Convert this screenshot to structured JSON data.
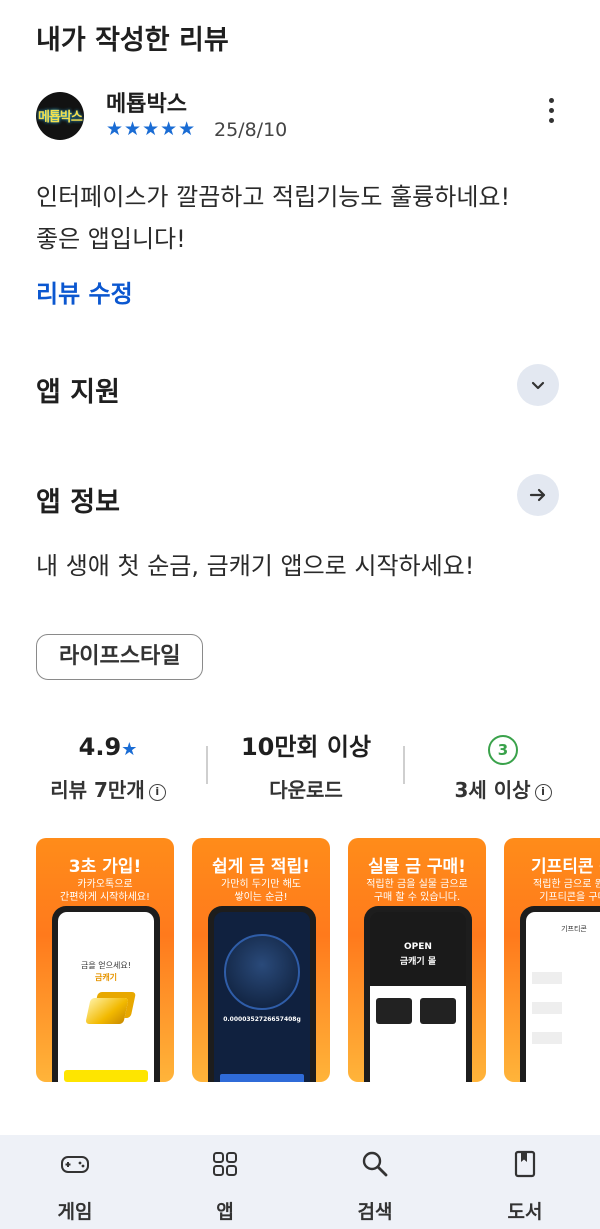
{
  "my_review": {
    "section_title": "내가 작성한 리뷰",
    "reviewer_name": "메툡박스",
    "avatar_text": "메툡박스",
    "stars": "★★★★★",
    "rating": 5,
    "date": "25/8/10",
    "text_line1": "인터페이스가 깔끔하고 적립기능도 훌륭하네요!",
    "text_line2": "좋은 앱입니다!",
    "edit_label": "리뷰 수정"
  },
  "app_support": {
    "title": "앱 지원"
  },
  "app_info": {
    "title": "앱 정보",
    "description": "내 생애 첫 순금, 금캐기 앱으로 시작하세요!",
    "category_chip": "라이프스타일"
  },
  "stats": {
    "rating_value": "4.9",
    "rating_star": "★",
    "reviews_label": "리뷰 7만개",
    "downloads_value": "10만회 이상",
    "downloads_label": "다운로드",
    "age_value": "3",
    "age_label": "3세 이상"
  },
  "screenshots": [
    {
      "title": "3초 가입!",
      "subtitle": "카카오톡으로\n간편하게 시작하세요!",
      "screen_text1": "금을 얻으세요!",
      "screen_text2": "금캐기"
    },
    {
      "title": "쉽게 금 적립!",
      "subtitle": "가만히 두기만 해도\n쌓이는 순금!",
      "screen_text1": "0.0000352726657408g"
    },
    {
      "title": "실물 금 구매!",
      "subtitle": "적립한 금을 실물 금으로\n구매 할 수 있습니다.",
      "screen_text1": "OPEN",
      "screen_text2": "금캐기 몰"
    },
    {
      "title": "기프티콘 구",
      "subtitle": "적립한 금으로 원하\n기프티콘을 구매",
      "screen_text1": "기프티콘"
    }
  ],
  "bottom_nav": [
    {
      "label": "게임",
      "icon": "gamepad-icon"
    },
    {
      "label": "앱",
      "icon": "apps-grid-icon"
    },
    {
      "label": "검색",
      "icon": "search-icon"
    },
    {
      "label": "도서",
      "icon": "book-icon"
    }
  ],
  "colors": {
    "accent": "#0b57d0",
    "star": "#1a6cd4",
    "age_badge": "#3aa24b",
    "screenshot_orange": "#ff8c1a",
    "nav_bg": "#eef1f7"
  }
}
